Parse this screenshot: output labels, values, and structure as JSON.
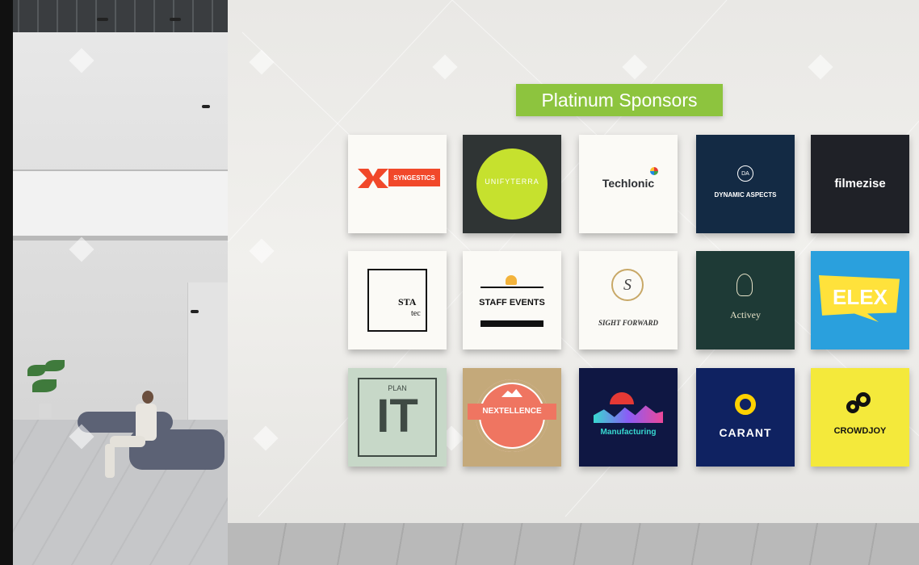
{
  "banner": {
    "title": "Platinum Sponsors"
  },
  "sponsors": [
    {
      "name": "SYNGESTICS",
      "bg": "#fbfaf6",
      "accent": "#f1482a"
    },
    {
      "name": "UNIFYTERRA",
      "bg": "#2f3434",
      "accent": "#c6e12e"
    },
    {
      "name": "Techlonic",
      "bg": "#fbfaf6",
      "accent": "#2c2f33"
    },
    {
      "name": "DYNAMIC ASPECTS",
      "bg": "#132a44",
      "accent": "#ffffff",
      "monogram": "DA"
    },
    {
      "name": "filmezise",
      "bg": "#1f2127",
      "accent": "#ffffff"
    },
    {
      "name": "STA",
      "sub": "tec",
      "bg": "#fbfaf6",
      "accent": "#111111"
    },
    {
      "name": "STAFF EVENTS",
      "bg": "#fbfaf6",
      "accent": "#111111"
    },
    {
      "name": "SIGHT FORWARD",
      "bg": "#fbfaf6",
      "accent": "#c8a867",
      "monogram": "S"
    },
    {
      "name": "Activey",
      "bg": "#1e3a36",
      "accent": "#e6e2c8"
    },
    {
      "name": "ELEX",
      "bg": "#2aa0dd",
      "accent": "#ffe23b"
    },
    {
      "name": "PLAN",
      "sub": "IT",
      "bg": "#c7d8c8",
      "accent": "#3f4a44"
    },
    {
      "name": "NEXTELLENCE",
      "bg": "#c4a97a",
      "accent": "#ef7561"
    },
    {
      "name": "Manufacturing",
      "bg": "#0f1743",
      "accent": "#38d8d0"
    },
    {
      "name": "CARANT",
      "bg": "#0f2261",
      "accent": "#ffd200"
    },
    {
      "name": "CROWDJOY",
      "bg": "#f4e93b",
      "accent": "#111111"
    }
  ]
}
